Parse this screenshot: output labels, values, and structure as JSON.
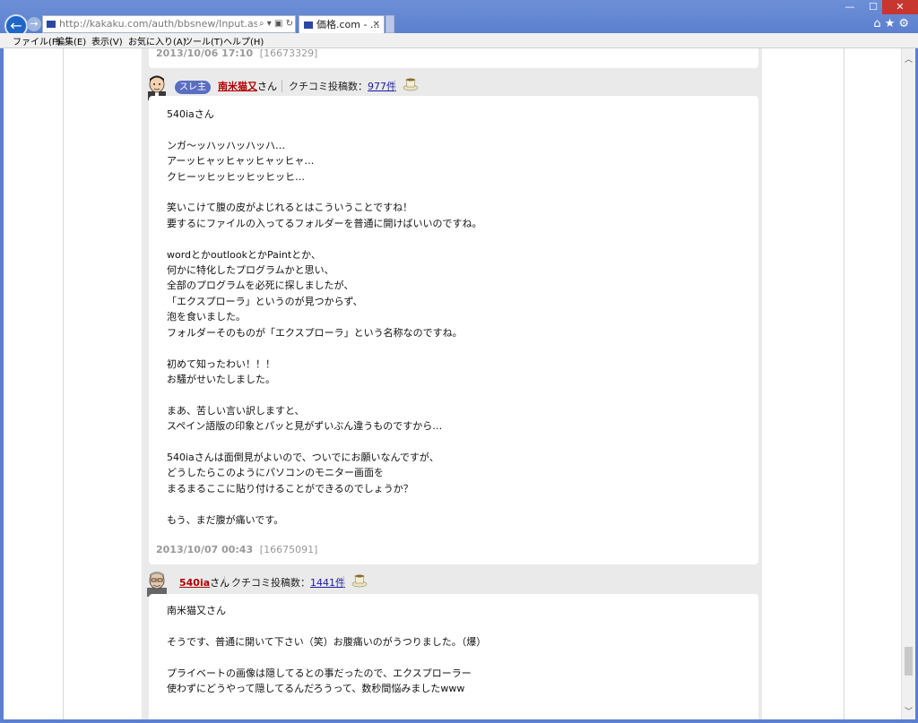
{
  "browser": {
    "address": "http://kakaku.com/auth/bbsnew/Input.asp?Par",
    "address_domain": "kakaku.com",
    "tab_title": "価格.com - ...",
    "win_min": "—",
    "win_max": "☐",
    "win_close": "✕",
    "icons": [
      "home-icon",
      "star-icon",
      "gear-icon"
    ]
  },
  "menu": {
    "file": "ファイル(F)",
    "edit": "編集(E)",
    "view": "表示(V)",
    "favorites": "お気に入り(A)",
    "tools": "ツール(T)",
    "help": "ヘルプ(H)"
  },
  "posts": [
    {
      "date": "2013/10/06 17:10",
      "id": "[16673329]"
    },
    {
      "badge": "スレ主",
      "user": "南米猫又",
      "san": "さん",
      "count_label": "クチコミ投稿数：",
      "count": "977件",
      "body": "540iaさん\n\nンガ～ッハッハッハッハ…\nアーッヒャッヒャッヒャッヒャ…\nクヒーッヒッヒッヒッヒッヒ…\n\n笑いこけて腹の皮がよじれるとはこういうことですね！\n要するにファイルの入ってるフォルダーを普通に開けばいいのですね。\n\nwordとかoutlookとかPaintとか、\n何かに特化したプログラムかと思い、\n全部のプログラムを必死に探しましたが、\n「エクスプローラ」というのが見つからず、\n泡を食いました。\nフォルダーそのものが「エクスプローラ」という名称なのですね。\n\n初めて知ったわい！！！\nお騒がせいたしました。\n\nまあ、苦しい言い訳しますと、\nスペイン語版の印象とパッと見がずいぶん違うものですから…\n\n540iaさんは面倒見がよいので、ついでにお願いなんですが、\nどうしたらこのようにパソコンのモニター画面を\nまるまるここに貼り付けることができるのでしょうか？\n\nもう、まだ腹が痛いです。",
      "date": "2013/10/07 00:43",
      "id": "[16675091]"
    },
    {
      "user": "540ia",
      "san": "さん",
      "count_label": "クチコミ投稿数：",
      "count": "1441件",
      "body": "南米猫又さん\n\nそうです、普通に開いて下さい（笑）お腹痛いのがうつりました。（爆）\n\nプライベートの画像は隠してるとの事だったので、エクスプローラー\n使わずにどうやって隠してるんだろうって、数秒間悩みましたwww"
    }
  ]
}
